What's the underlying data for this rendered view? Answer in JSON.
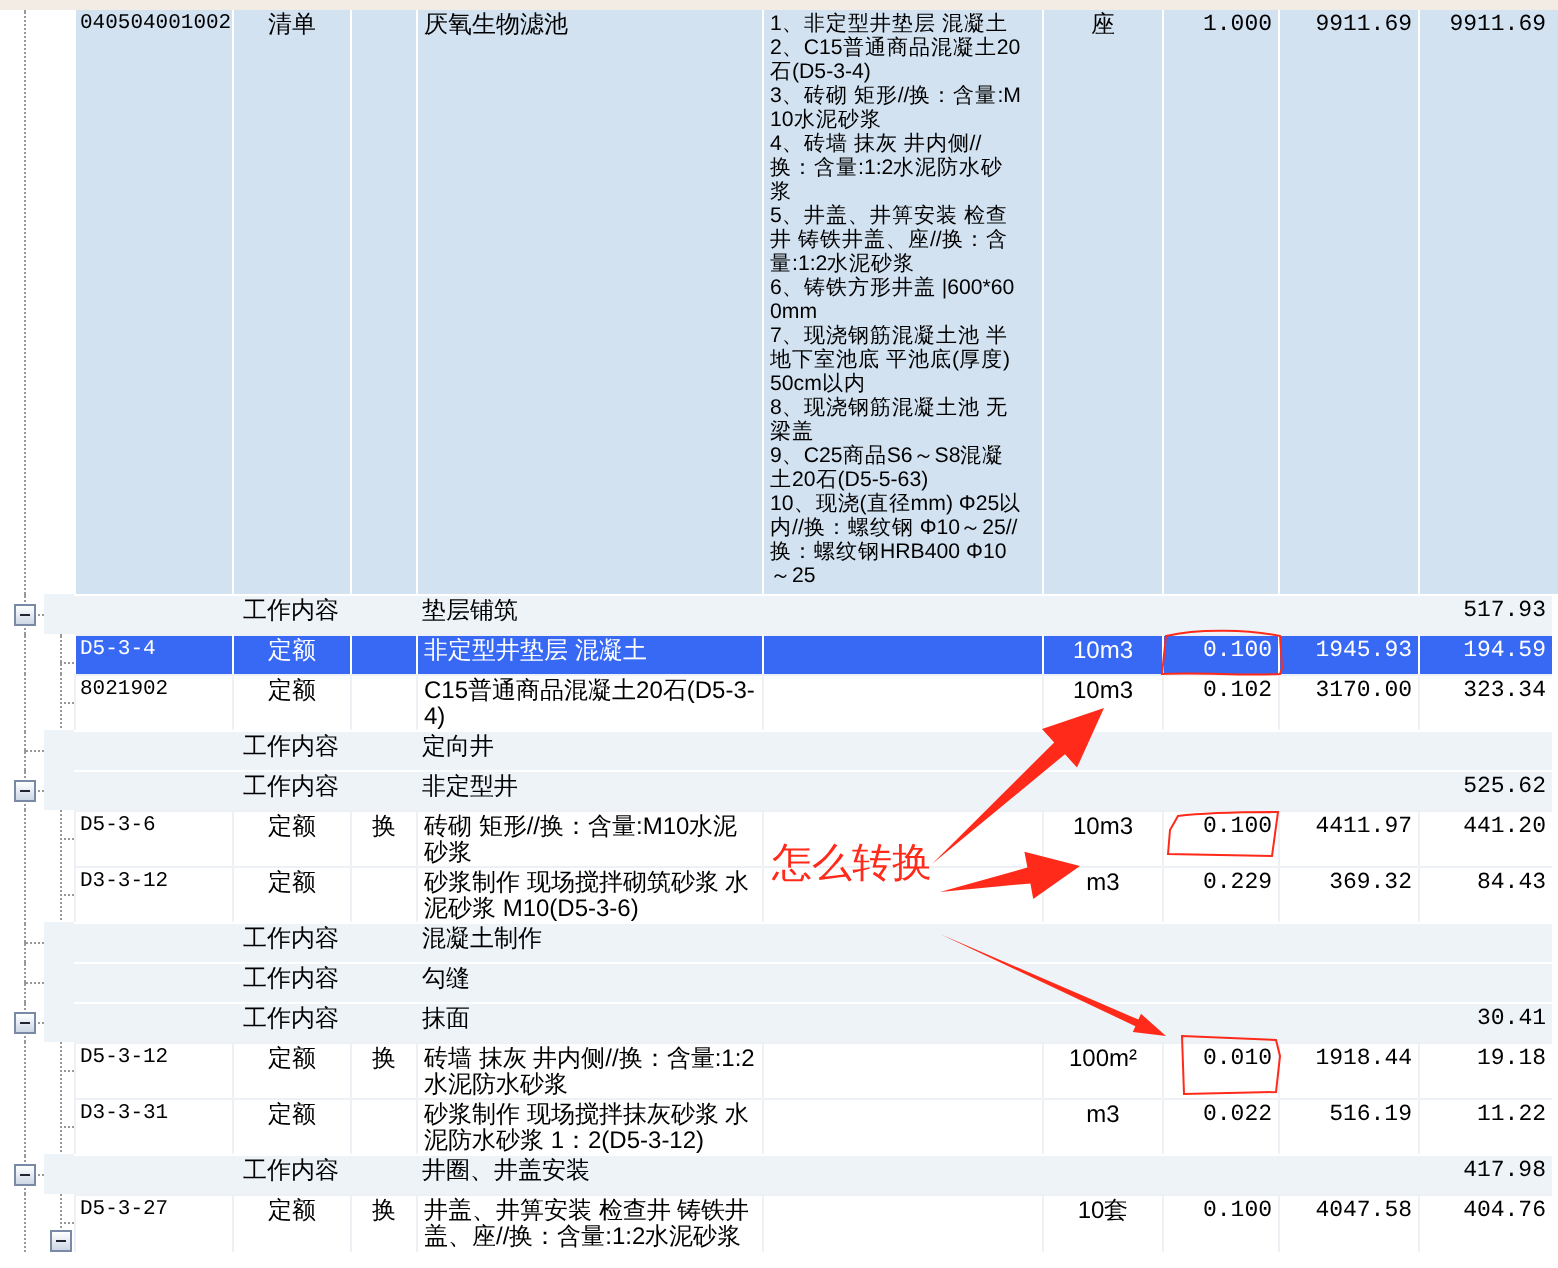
{
  "bill": {
    "code": "040504001002",
    "type": "清单",
    "name": "厌氧生物滤池",
    "description": [
      "1、非定型井垫层 混凝土",
      "2、C15普通商品混凝土20石(D5-3-4)",
      "3、砖砌 矩形//换：含量:M10水泥砂浆",
      "4、砖墙 抹灰 井内侧//换：含量:1:2水泥防水砂浆",
      "5、井盖、井箅安装 检查井 铸铁井盖、座//换：含量:1:2水泥砂浆",
      "6、铸铁方形井盖 |600*600mm",
      "7、现浇钢筋混凝土池 半地下室池底 平池底(厚度) 50cm以内",
      "8、现浇钢筋混凝土池 无梁盖",
      "9、C25商品S6～S8混凝土20石(D5-5-63)",
      "10、现浇(直径mm) Φ25以内//换：螺纹钢 Φ10～25//换：螺纹钢HRB400 Φ10～25"
    ],
    "unit": "座",
    "quantity": "1.000",
    "unit_price": "9911.69",
    "total": "9911.69"
  },
  "groups": [
    {
      "type": "工作内容",
      "name": "垫层铺筑",
      "total": "517.93",
      "expanded": true,
      "children": [
        {
          "code": "D5-3-4",
          "type": "定额",
          "name": "非定型井垫层 混凝土",
          "unit": "10m3",
          "quantity": "0.100",
          "unit_price": "1945.93",
          "total": "194.59",
          "selected": true
        },
        {
          "code": "8021902",
          "type": "定额",
          "name": "C15普通商品混凝土20石(D5-3-4)",
          "unit": "10m3",
          "quantity": "0.102",
          "unit_price": "3170.00",
          "total": "323.34",
          "selected": false
        }
      ]
    },
    {
      "type": "工作内容",
      "name": "定向井"
    },
    {
      "type": "工作内容",
      "name": "非定型井",
      "total": "525.62",
      "expanded": true,
      "children": [
        {
          "code": "D5-3-6",
          "type": "定额",
          "swap": "换",
          "name": "砖砌 矩形//换：含量:M10水泥砂浆",
          "unit": "10m3",
          "quantity": "0.100",
          "unit_price": "4411.97",
          "total": "441.20",
          "selected": false
        },
        {
          "code": "D3-3-12",
          "type": "定额",
          "name": "砂浆制作 现场搅拌砌筑砂浆 水泥砂浆 M10(D5-3-6)",
          "unit": "m3",
          "quantity": "0.229",
          "unit_price": "369.32",
          "total": "84.43",
          "selected": false
        }
      ]
    },
    {
      "type": "工作内容",
      "name": "混凝土制作"
    },
    {
      "type": "工作内容",
      "name": "勾缝"
    },
    {
      "type": "工作内容",
      "name": "抹面",
      "total": "30.41",
      "expanded": true,
      "children": [
        {
          "code": "D5-3-12",
          "type": "定额",
          "swap": "换",
          "name": "砖墙 抹灰 井内侧//换：含量:1:2水泥防水砂浆",
          "unit": "100m²",
          "quantity": "0.010",
          "unit_price": "1918.44",
          "total": "19.18",
          "selected": false
        },
        {
          "code": "D3-3-31",
          "type": "定额",
          "name": "砂浆制作 现场搅拌抹灰砂浆 水泥防水砂浆 1：2(D5-3-12)",
          "unit": "m3",
          "quantity": "0.022",
          "unit_price": "516.19",
          "total": "11.22",
          "selected": false
        }
      ]
    },
    {
      "type": "工作内容",
      "name": "井圈、井盖安装",
      "total": "417.98",
      "expanded": true,
      "children": [
        {
          "code": "D5-3-27",
          "type": "定额",
          "swap": "换",
          "name": "井盖、井箅安装 检查井 铸铁井盖、座//换：含量:1:2水泥砂浆",
          "unit": "10套",
          "quantity": "0.100",
          "unit_price": "4047.58",
          "total": "404.76",
          "selected": false,
          "expanded": true
        }
      ]
    }
  ],
  "annotation": {
    "text": "怎么转换"
  }
}
